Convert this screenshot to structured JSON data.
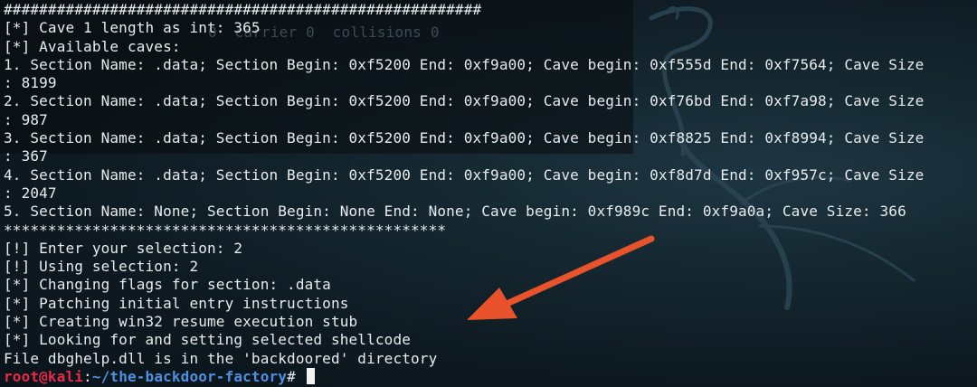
{
  "terminal": {
    "lines": [
      "######################################################",
      "[*] Cave 1 length as int: 365",
      "[*] Available caves:",
      "1. Section Name: .data; Section Begin: 0xf5200 End: 0xf9a00; Cave begin: 0xf555d End: 0xf7564; Cave Size",
      ": 8199",
      "2. Section Name: .data; Section Begin: 0xf5200 End: 0xf9a00; Cave begin: 0xf76bd End: 0xf7a98; Cave Size",
      ": 987",
      "3. Section Name: .data; Section Begin: 0xf5200 End: 0xf9a00; Cave begin: 0xf8825 End: 0xf8994; Cave Size",
      ": 367",
      "4. Section Name: .data; Section Begin: 0xf5200 End: 0xf9a00; Cave begin: 0xf8d7d End: 0xf957c; Cave Size",
      ": 2047",
      "5. Section Name: None; Section Begin: None End: None; Cave begin: 0xf989c End: 0xf9a0a; Cave Size: 366",
      "**************************************************",
      "[!] Enter your selection: 2",
      "[!] Using selection: 2",
      "[*] Changing flags for section: .data",
      "[*] Patching initial entry instructions",
      "[*] Creating win32 resume execution stub",
      "[*] Looking for and setting selected shellcode",
      "File dbghelp.dll is in the 'backdoored' directory"
    ],
    "ghost_text": "0  carrier 0  collisions 0",
    "prompt": {
      "user_host": "root@kali",
      "colon": ":",
      "path": "~/the-backdoor-factory",
      "symbol": "# "
    }
  },
  "colors": {
    "background": "#0e1a22",
    "text": "#e8ecee",
    "prompt_user": "#e8294a",
    "prompt_path": "#4f8fe0",
    "arrow": "#e8532c"
  },
  "icons": {
    "annotation": "arrow-annotation-icon",
    "watermark": "kali-dragon-icon"
  }
}
